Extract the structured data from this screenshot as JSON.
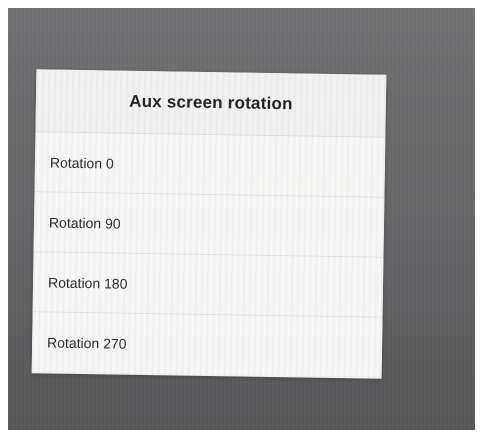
{
  "dialog": {
    "title": "Aux screen rotation",
    "options": [
      {
        "label": "Rotation 0"
      },
      {
        "label": "Rotation 90"
      },
      {
        "label": "Rotation 180"
      },
      {
        "label": "Rotation 270"
      }
    ]
  },
  "colors": {
    "screen_background": "#676769",
    "dialog_background": "#f2f2f1",
    "title_text": "#222222",
    "option_text": "#2b2b2b",
    "divider": "#dedede"
  }
}
